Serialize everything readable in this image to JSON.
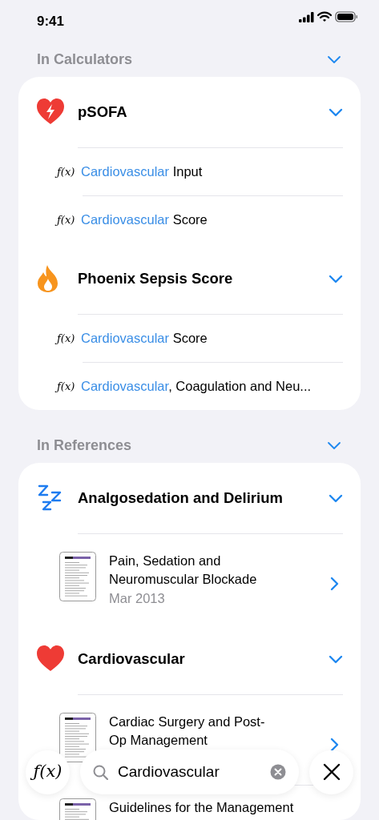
{
  "status_bar": {
    "time": "9:41"
  },
  "sections": [
    {
      "title": "In Calculators",
      "expanded": true,
      "groups": [
        {
          "title": "pSOFA",
          "kind": "bolt",
          "expanded": true,
          "items": [
            {
              "kind": "formula",
              "symbol": "ƒ(x)",
              "match": "Cardiovascular",
              "rest": " Input"
            },
            {
              "kind": "formula",
              "symbol": "ƒ(x)",
              "match": "Cardiovascular",
              "rest": " Score"
            }
          ]
        },
        {
          "title": "Phoenix Sepsis Score",
          "kind": "flame",
          "expanded": true,
          "items": [
            {
              "kind": "formula",
              "symbol": "ƒ(x)",
              "match": "Cardiovascular",
              "rest": " Score"
            },
            {
              "kind": "formula",
              "symbol": "ƒ(x)",
              "match": "Cardiovascular",
              "rest": ", Coagulation and Neu..."
            }
          ]
        }
      ]
    },
    {
      "title": "In References",
      "expanded": true,
      "groups": [
        {
          "title": "Analgosedation and Delirium",
          "kind": "sleep",
          "expanded": true,
          "items": [
            {
              "kind": "document",
              "title": "Pain, Sedation and\nNeuromuscular  Blockade",
              "date": "Mar 2013"
            }
          ]
        },
        {
          "title": "Cardiovascular",
          "kind": "heart",
          "expanded": true,
          "items": [
            {
              "kind": "document",
              "title": "Cardiac Surgery and Post-\nOp Management"
            },
            {
              "kind": "document",
              "title": "Guidelines for the Management"
            }
          ]
        }
      ]
    }
  ],
  "bottom_bar": {
    "formula_button": "ƒ(x)",
    "search_value": "Cardiovascular"
  }
}
